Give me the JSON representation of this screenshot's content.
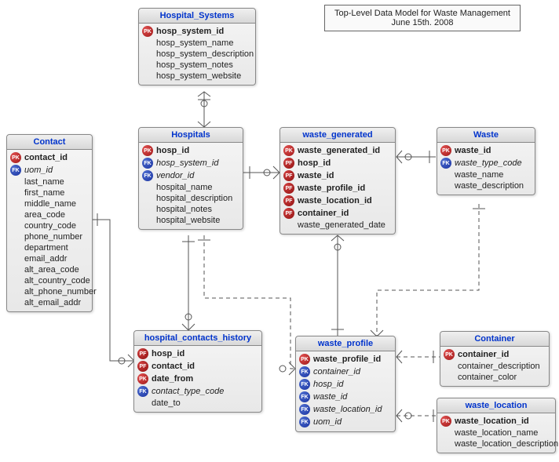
{
  "title": {
    "line1": "Top-Level Data Model for Waste Management",
    "line2": "June 15th. 2008"
  },
  "entities": {
    "hospital_systems": {
      "name": "Hospital_Systems",
      "attrs": [
        {
          "key": "PK",
          "label": "hosp_system_id",
          "bold": true
        },
        {
          "key": "",
          "label": "hosp_system_name"
        },
        {
          "key": "",
          "label": "hosp_system_description"
        },
        {
          "key": "",
          "label": "hosp_system_notes"
        },
        {
          "key": "",
          "label": "hosp_system_website"
        }
      ]
    },
    "contact": {
      "name": "Contact",
      "attrs": [
        {
          "key": "PK",
          "label": "contact_id",
          "bold": true
        },
        {
          "key": "FK",
          "label": "uom_id",
          "italic": true
        },
        {
          "key": "",
          "label": "last_name"
        },
        {
          "key": "",
          "label": "first_name"
        },
        {
          "key": "",
          "label": "middle_name"
        },
        {
          "key": "",
          "label": "area_code"
        },
        {
          "key": "",
          "label": "country_code"
        },
        {
          "key": "",
          "label": "phone_number"
        },
        {
          "key": "",
          "label": "department"
        },
        {
          "key": "",
          "label": "email_addr"
        },
        {
          "key": "",
          "label": "alt_area_code"
        },
        {
          "key": "",
          "label": "alt_country_code"
        },
        {
          "key": "",
          "label": "alt_phone_number"
        },
        {
          "key": "",
          "label": "alt_email_addr"
        }
      ]
    },
    "hospitals": {
      "name": "Hospitals",
      "attrs": [
        {
          "key": "PK",
          "label": "hosp_id",
          "bold": true
        },
        {
          "key": "FK",
          "label": "hosp_system_id",
          "italic": true
        },
        {
          "key": "FK",
          "label": "vendor_id",
          "italic": true
        },
        {
          "key": "",
          "label": "hospital_name"
        },
        {
          "key": "",
          "label": "hospital_description"
        },
        {
          "key": "",
          "label": "hospital_notes"
        },
        {
          "key": "",
          "label": "hospital_website"
        }
      ]
    },
    "waste_generated": {
      "name": "waste_generated",
      "attrs": [
        {
          "key": "PK",
          "label": "waste_generated_id",
          "bold": true
        },
        {
          "key": "PF",
          "label": "hosp_id",
          "bold": true
        },
        {
          "key": "PF",
          "label": "waste_id",
          "bold": true
        },
        {
          "key": "PF",
          "label": "waste_profile_id",
          "bold": true
        },
        {
          "key": "PF",
          "label": "waste_location_id",
          "bold": true
        },
        {
          "key": "PF",
          "label": "container_id",
          "bold": true
        },
        {
          "key": "",
          "label": "waste_generated_date"
        }
      ]
    },
    "waste": {
      "name": "Waste",
      "attrs": [
        {
          "key": "PK",
          "label": "waste_id",
          "bold": true
        },
        {
          "key": "FK",
          "label": "waste_type_code",
          "italic": true
        },
        {
          "key": "",
          "label": "waste_name"
        },
        {
          "key": "",
          "label": "waste_description"
        }
      ]
    },
    "hospital_contacts_history": {
      "name": "hospital_contacts_history",
      "attrs": [
        {
          "key": "PF",
          "label": "hosp_id",
          "bold": true
        },
        {
          "key": "PF",
          "label": "contact_id",
          "bold": true
        },
        {
          "key": "PK",
          "label": "date_from",
          "bold": true
        },
        {
          "key": "FK",
          "label": "contact_type_code",
          "italic": true
        },
        {
          "key": "",
          "label": "date_to"
        }
      ]
    },
    "waste_profile": {
      "name": "waste_profile",
      "attrs": [
        {
          "key": "PK",
          "label": "waste_profile_id",
          "bold": true
        },
        {
          "key": "FK",
          "label": "container_id",
          "italic": true
        },
        {
          "key": "FK",
          "label": "hosp_id",
          "italic": true
        },
        {
          "key": "FK",
          "label": "waste_id",
          "italic": true
        },
        {
          "key": "FK",
          "label": "waste_location_id",
          "italic": true
        },
        {
          "key": "FK",
          "label": "uom_id",
          "italic": true
        }
      ]
    },
    "container": {
      "name": "Container",
      "attrs": [
        {
          "key": "PK",
          "label": "container_id",
          "bold": true
        },
        {
          "key": "",
          "label": "container_description"
        },
        {
          "key": "",
          "label": "container_color"
        }
      ]
    },
    "waste_location": {
      "name": "waste_location",
      "attrs": [
        {
          "key": "PK",
          "label": "waste_location_id",
          "bold": true
        },
        {
          "key": "",
          "label": "waste_location_name"
        },
        {
          "key": "",
          "label": "waste_location_description"
        }
      ]
    }
  }
}
